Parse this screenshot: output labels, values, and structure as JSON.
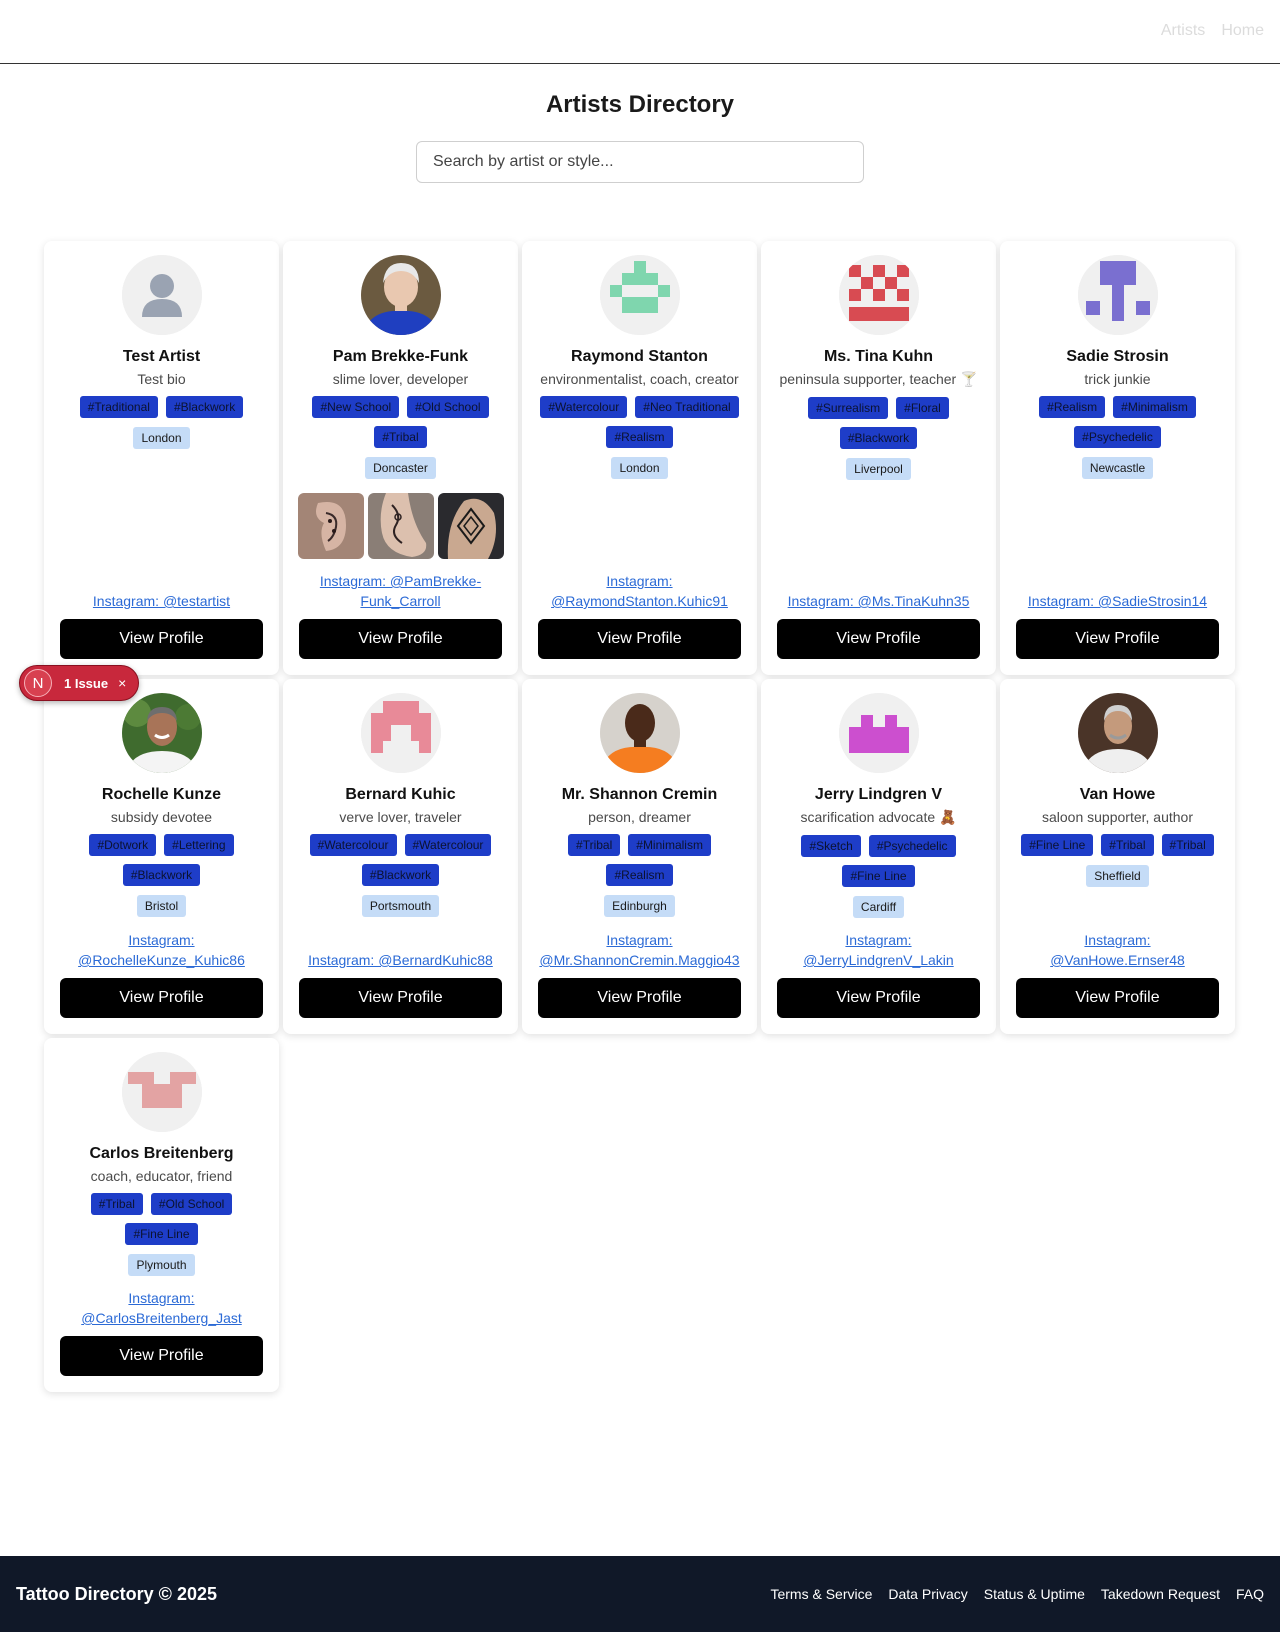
{
  "nav": {
    "links": [
      "Artists",
      "Home"
    ]
  },
  "page": {
    "title": "Artists Directory"
  },
  "search": {
    "placeholder": "Search by artist or style..."
  },
  "artists": [
    {
      "name": "Test Artist",
      "bio": "Test bio",
      "tags": [
        "#Traditional",
        "#Blackwork"
      ],
      "location": "London",
      "instagram": "Instagram: @testartist",
      "button": "View Profile",
      "avatar": "default-person-avatar",
      "gallery": []
    },
    {
      "name": "Pam Brekke-Funk",
      "bio": "slime lover, developer",
      "tags": [
        "#New School",
        "#Old School",
        "#Tribal"
      ],
      "location": "Doncaster",
      "instagram": "Instagram: @PamBrekke-Funk_Carroll",
      "button": "View Profile",
      "avatar": "photo-elderly-woman",
      "gallery": [
        "ear-tattoo-photo",
        "foot-tattoo-photo",
        "hand-tattoo-photo"
      ]
    },
    {
      "name": "Raymond Stanton",
      "bio": "environmentalist, coach, creator",
      "tags": [
        "#Watercolour",
        "#Neo Traditional",
        "#Realism"
      ],
      "location": "London",
      "instagram": "Instagram: @RaymondStanton.Kuhic91",
      "button": "View Profile",
      "avatar": "identicon-green",
      "gallery": []
    },
    {
      "name": "Ms. Tina Kuhn",
      "bio": "peninsula supporter, teacher 🍸",
      "tags": [
        "#Surrealism",
        "#Floral",
        "#Blackwork"
      ],
      "location": "Liverpool",
      "instagram": "Instagram: @Ms.TinaKuhn35",
      "button": "View Profile",
      "avatar": "identicon-red",
      "gallery": []
    },
    {
      "name": "Sadie Strosin",
      "bio": "trick junkie",
      "tags": [
        "#Realism",
        "#Minimalism",
        "#Psychedelic"
      ],
      "location": "Newcastle",
      "instagram": "Instagram: @SadieStrosin14",
      "button": "View Profile",
      "avatar": "identicon-purple",
      "gallery": []
    },
    {
      "name": "Rochelle Kunze",
      "bio": "subsidy devotee",
      "tags": [
        "#Dotwork",
        "#Lettering",
        "#Blackwork"
      ],
      "location": "Bristol",
      "instagram": "Instagram: @RochelleKunze_Kuhic86",
      "button": "View Profile",
      "avatar": "photo-man-smiling",
      "gallery": []
    },
    {
      "name": "Bernard Kuhic",
      "bio": "verve lover, traveler",
      "tags": [
        "#Watercolour",
        "#Watercolour",
        "#Blackwork"
      ],
      "location": "Portsmouth",
      "instagram": "Instagram: @BernardKuhic88",
      "button": "View Profile",
      "avatar": "identicon-pink",
      "gallery": []
    },
    {
      "name": "Mr. Shannon Cremin",
      "bio": "person, dreamer",
      "tags": [
        "#Tribal",
        "#Minimalism",
        "#Realism"
      ],
      "location": "Edinburgh",
      "instagram": "Instagram: @Mr.ShannonCremin.Maggio43",
      "button": "View Profile",
      "avatar": "photo-man-orange-shirt",
      "gallery": []
    },
    {
      "name": "Jerry Lindgren V",
      "bio": "scarification advocate 🧸",
      "tags": [
        "#Sketch",
        "#Psychedelic",
        "#Fine Line"
      ],
      "location": "Cardiff",
      "instagram": "Instagram: @JerryLindgrenV_Lakin",
      "button": "View Profile",
      "avatar": "identicon-magenta",
      "gallery": []
    },
    {
      "name": "Van Howe",
      "bio": "saloon supporter, author",
      "tags": [
        "#Fine Line",
        "#Tribal",
        "#Tribal"
      ],
      "location": "Sheffield",
      "instagram": "Instagram: @VanHowe.Ernser48",
      "button": "View Profile",
      "avatar": "photo-man-white-shirt",
      "gallery": []
    },
    {
      "name": "Carlos Breitenberg",
      "bio": "coach, educator, friend",
      "tags": [
        "#Tribal",
        "#Old School",
        "#Fine Line"
      ],
      "location": "Plymouth",
      "instagram": "Instagram: @CarlosBreitenberg_Jast",
      "button": "View Profile",
      "avatar": "identicon-salmon",
      "gallery": []
    }
  ],
  "issues_badge": {
    "initial": "N",
    "label": "1 Issue",
    "close": "×"
  },
  "footer": {
    "brand": "Tattoo Directory © 2025",
    "links": [
      "Terms & Service",
      "Data Privacy",
      "Status & Uptime",
      "Takedown Request",
      "FAQ"
    ]
  },
  "colors": {
    "tag_bg": "#1e3dc8",
    "location_bg": "#c5dcf7",
    "link": "#2b6ad6",
    "button": "#000000",
    "footer_bg": "#101828",
    "issue_badge": "#c8283c"
  }
}
